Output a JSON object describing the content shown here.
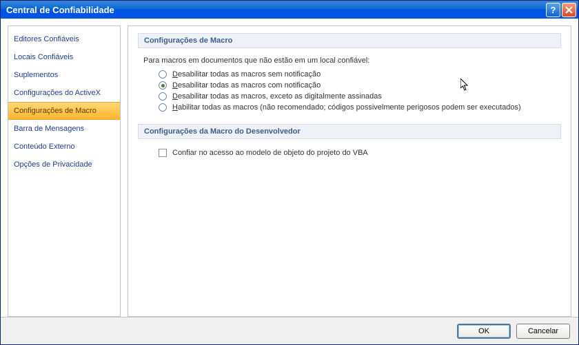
{
  "window": {
    "title": "Central de Confiabilidade"
  },
  "sidebar": {
    "items": [
      {
        "label": "Editores Confiáveis",
        "selected": false
      },
      {
        "label": "Locais Confiáveis",
        "selected": false
      },
      {
        "label": "Suplementos",
        "selected": false
      },
      {
        "label": "Configurações do ActiveX",
        "selected": false
      },
      {
        "label": "Configurações de Macro",
        "selected": true
      },
      {
        "label": "Barra de Mensagens",
        "selected": false
      },
      {
        "label": "Conteúdo Externo",
        "selected": false
      },
      {
        "label": "Opções de Privacidade",
        "selected": false
      }
    ]
  },
  "main": {
    "section1_title": "Configurações de Macro",
    "intro": "Para macros em documentos que não estão em um local confiável:",
    "options": [
      {
        "accel": "D",
        "rest": "esabilitar todas as macros sem notificação",
        "checked": false
      },
      {
        "accel": "D",
        "rest": "esabilitar todas as macros com notificação",
        "checked": true
      },
      {
        "accel": "D",
        "rest": "esabilitar todas as macros, exceto as digitalmente assinadas",
        "checked": false
      },
      {
        "accel": "H",
        "rest": "abilitar todas as macros (não recomendado; códigos possivelmente perigosos podem ser executados)",
        "checked": false
      }
    ],
    "section2_title": "Configurações da Macro do Desenvolvedor",
    "trust_label": "Confiar no acesso ao modelo de objeto do projeto do VBA",
    "trust_checked": false
  },
  "footer": {
    "ok": "OK",
    "cancel": "Cancelar"
  },
  "colors": {
    "titlebar_start": "#3a84df",
    "titlebar_end": "#0054e3",
    "selected_start": "#ffd978",
    "selected_end": "#ffb52e",
    "link": "#1e3e8c",
    "section_bg": "#eef2f7",
    "section_text": "#3b5d8a"
  }
}
